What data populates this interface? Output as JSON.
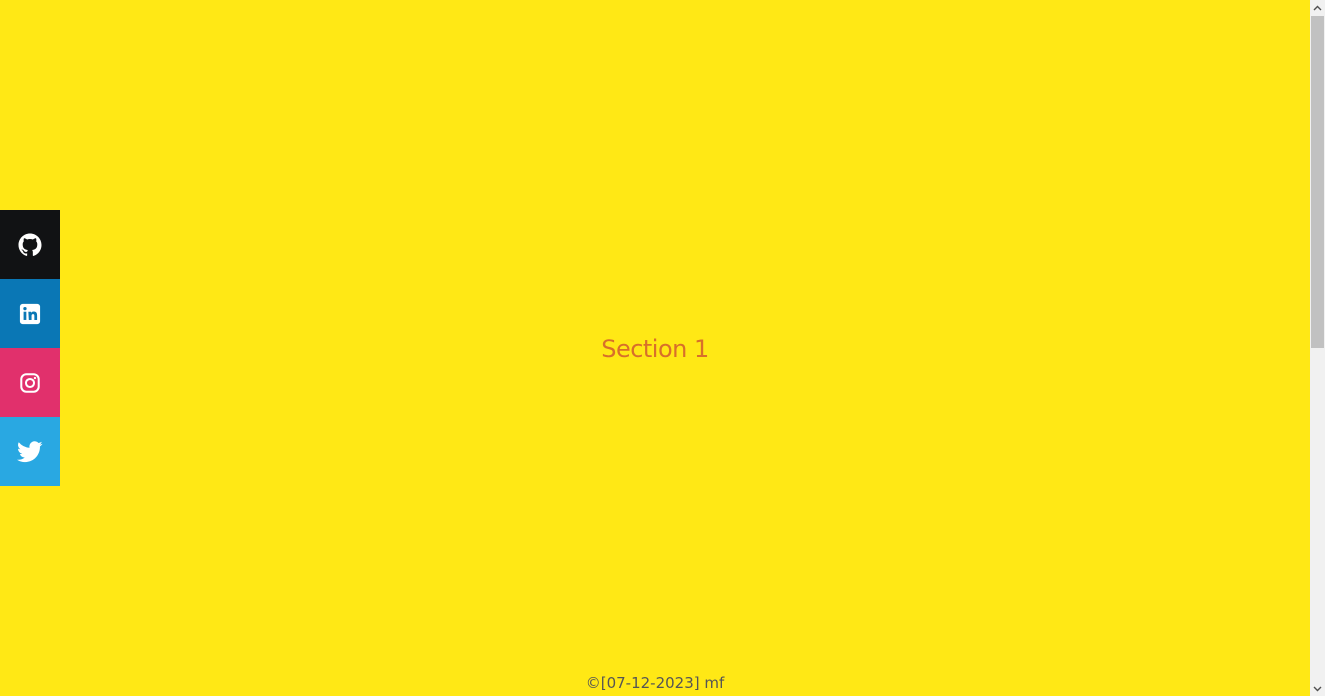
{
  "colors": {
    "background": "#ffe815",
    "title": "#d86f2a",
    "footer": "#555555",
    "icon": "#ffffff",
    "github": "#111214",
    "linkedin": "#0a77b5",
    "instagram": "#e1306c",
    "twitter": "#29a8e2"
  },
  "section": {
    "title": "Section 1"
  },
  "footer": {
    "text": "©[07-12-2023] mf"
  },
  "social": [
    {
      "name": "github",
      "icon": "github-icon"
    },
    {
      "name": "linkedin",
      "icon": "linkedin-icon"
    },
    {
      "name": "instagram",
      "icon": "instagram-icon"
    },
    {
      "name": "twitter",
      "icon": "twitter-icon"
    }
  ]
}
